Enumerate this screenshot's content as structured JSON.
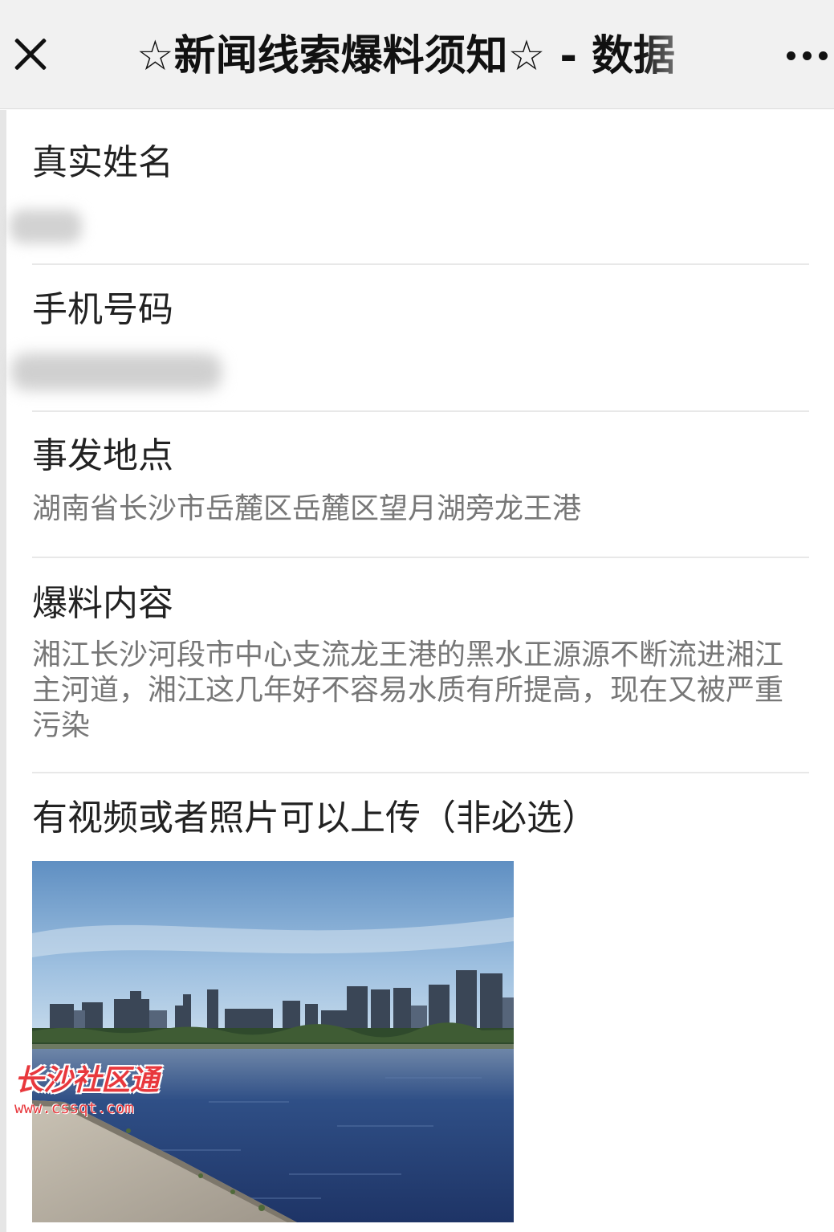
{
  "header": {
    "title": "☆新闻线索爆料须知☆ - 数据"
  },
  "icons": {
    "close": "close-icon",
    "more": "more-icon"
  },
  "form": {
    "fields": [
      {
        "label": "真实姓名",
        "value": ""
      },
      {
        "label": "手机号码",
        "value": ""
      },
      {
        "label": "事发地点",
        "value": "湖南省长沙市岳麓区岳麓区望月湖旁龙王港"
      },
      {
        "label": "爆料内容",
        "value": "湘江长沙河段市中心支流龙王港的黑水正源源不断流进湘江主河道，湘江这几年好不容易水质有所提高，现在又被严重污染"
      }
    ],
    "upload_label": "有视频或者照片可以上传（非必选）"
  },
  "watermark": {
    "text": "长沙社区通",
    "url": "www.cssqt.com"
  },
  "colors": {
    "topbar_bg": "#f1f1f1",
    "value_text": "#777777",
    "watermark": "#e8383d"
  }
}
